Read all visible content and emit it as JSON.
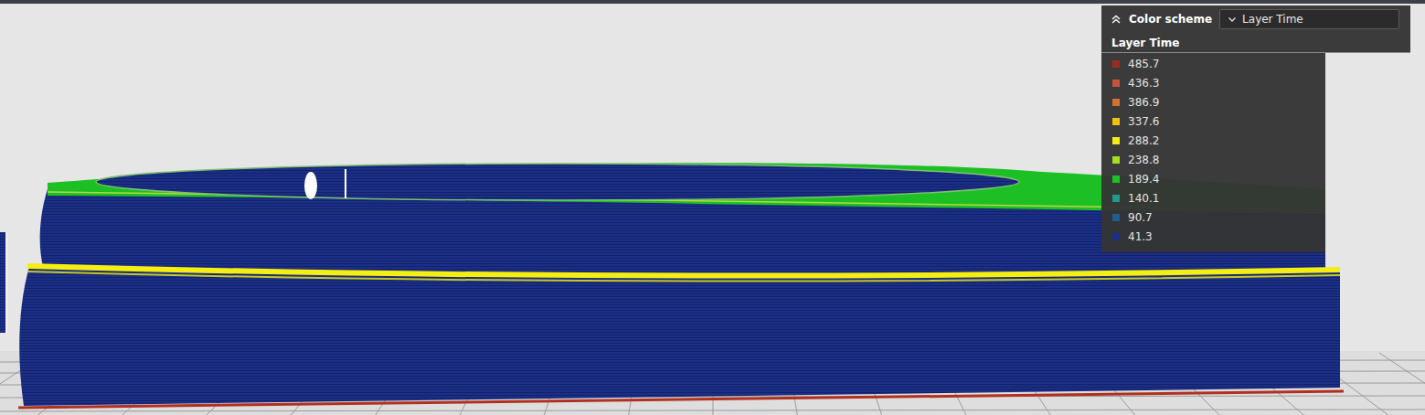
{
  "color_scheme": {
    "label": "Color scheme",
    "value": "Layer Time",
    "expanded": true
  },
  "legend": {
    "title": "Layer Time",
    "items": [
      {
        "value": "485.7",
        "color": "#9b2d1f"
      },
      {
        "value": "436.3",
        "color": "#c4553a"
      },
      {
        "value": "386.9",
        "color": "#d2732f"
      },
      {
        "value": "337.6",
        "color": "#f0c20f"
      },
      {
        "value": "288.2",
        "color": "#f5ee12"
      },
      {
        "value": "238.8",
        "color": "#a2e020"
      },
      {
        "value": "189.4",
        "color": "#1cc024"
      },
      {
        "value": "140.1",
        "color": "#1f9a8c"
      },
      {
        "value": "90.7",
        "color": "#1d5f8a"
      },
      {
        "value": "41.3",
        "color": "#1b2f8a"
      }
    ]
  }
}
